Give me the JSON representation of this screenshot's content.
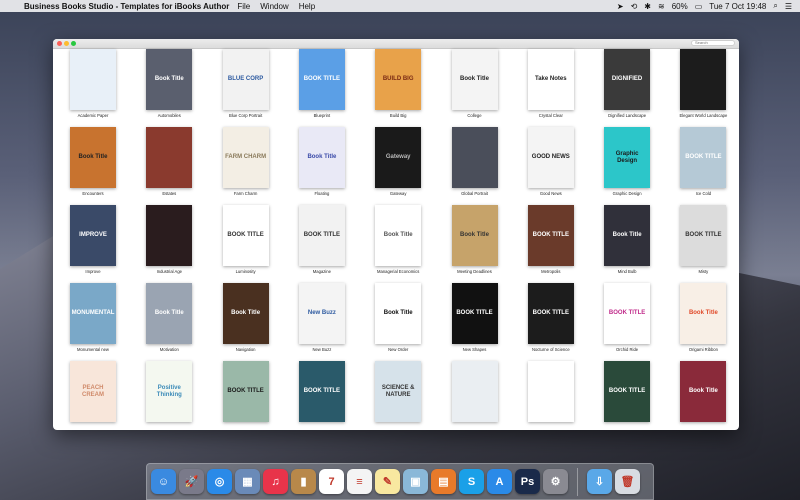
{
  "menubar": {
    "app_name": "Business Books Studio - Templates for iBooks Author",
    "menus": [
      "File",
      "Window",
      "Help"
    ],
    "battery": "60%",
    "datetime": "Tue 7 Oct  19:48"
  },
  "window": {
    "search_placeholder": "Search"
  },
  "templates": [
    {
      "name": "Academic Paper",
      "title": "",
      "bg": "#e8f0f8",
      "fg": "#2d6fb5"
    },
    {
      "name": "Automobiles",
      "title": "Book Title",
      "bg": "#5a5f6e",
      "fg": "#ffffff"
    },
    {
      "name": "Blue Corp Portrait",
      "title": "BLUE CORP",
      "bg": "#f2f2f2",
      "fg": "#2d5aa0"
    },
    {
      "name": "Blueprint",
      "title": "BOOK TITLE",
      "bg": "#5b9fe6",
      "fg": "#ffffff"
    },
    {
      "name": "Build Big",
      "title": "BUILD BIG",
      "bg": "#e8a24a",
      "fg": "#7a2a14"
    },
    {
      "name": "College",
      "title": "Book Title",
      "bg": "#f4f4f4",
      "fg": "#222222"
    },
    {
      "name": "Crystal Clear",
      "title": "Take Notes",
      "bg": "#ffffff",
      "fg": "#222222"
    },
    {
      "name": "Dignified Landscape",
      "title": "DIGNIFIED",
      "bg": "#3a3a3a",
      "fg": "#ffffff"
    },
    {
      "name": "Elegant World Landscape",
      "title": "",
      "bg": "#1c1c1c",
      "fg": "#ffffff"
    },
    {
      "name": "Encounters",
      "title": "Book Title",
      "bg": "#c8732f",
      "fg": "#222222"
    },
    {
      "name": "Estates",
      "title": "",
      "bg": "#8a3a2e",
      "fg": "#ffffff"
    },
    {
      "name": "Farm Charm",
      "title": "FARM CHARM",
      "bg": "#f3eee4",
      "fg": "#8a7a5a"
    },
    {
      "name": "Floating",
      "title": "Book Title",
      "bg": "#e9e9f6",
      "fg": "#3a4aa8"
    },
    {
      "name": "Gateway",
      "title": "Gateway",
      "bg": "#1a1a1a",
      "fg": "#bbbbbb"
    },
    {
      "name": "Global Portrait",
      "title": "",
      "bg": "#4a4e5a",
      "fg": "#ffffff"
    },
    {
      "name": "Good News",
      "title": "GOOD NEWS",
      "bg": "#f4f4f4",
      "fg": "#222222"
    },
    {
      "name": "Graphic Design",
      "title": "Graphic Design",
      "bg": "#2cc6c9",
      "fg": "#1a1a1a"
    },
    {
      "name": "Ice Cold",
      "title": "BOOK TITLE",
      "bg": "#b5c9d6",
      "fg": "#ffffff"
    },
    {
      "name": "Improve",
      "title": "IMPROVE",
      "bg": "#3a4a68",
      "fg": "#ffffff"
    },
    {
      "name": "Industrial Age",
      "title": "",
      "bg": "#2a1c1e",
      "fg": "#ffffff"
    },
    {
      "name": "Luminosity",
      "title": "BOOK TITLE",
      "bg": "#ffffff",
      "fg": "#333333"
    },
    {
      "name": "Magazine",
      "title": "BOOK TITLE",
      "bg": "#f2f2f2",
      "fg": "#333333"
    },
    {
      "name": "Managerial Economics",
      "title": "Book Title",
      "bg": "#ffffff",
      "fg": "#555555"
    },
    {
      "name": "Meeting Deadlines",
      "title": "Book Title",
      "bg": "#c6a36a",
      "fg": "#333333"
    },
    {
      "name": "Metropolis",
      "title": "BOOK TITLE",
      "bg": "#6a3a2a",
      "fg": "#ffffff"
    },
    {
      "name": "Mind Bulb",
      "title": "Book Title",
      "bg": "#30303a",
      "fg": "#ffffff"
    },
    {
      "name": "Misty",
      "title": "BOOK TITLE",
      "bg": "#dcdcdc",
      "fg": "#333333"
    },
    {
      "name": "Monumental new",
      "title": "MONUMENTAL",
      "bg": "#7aa8c8",
      "fg": "#ffffff"
    },
    {
      "name": "Motivation",
      "title": "Book Title",
      "bg": "#9aa4b2",
      "fg": "#ffffff"
    },
    {
      "name": "Navigation",
      "title": "Book Title",
      "bg": "#4a3020",
      "fg": "#ffffff"
    },
    {
      "name": "New Buzz",
      "title": "New Buzz",
      "bg": "#f4f4f4",
      "fg": "#2d5aa0"
    },
    {
      "name": "New Order",
      "title": "Book Title",
      "bg": "#ffffff",
      "fg": "#111111"
    },
    {
      "name": "New Shapes",
      "title": "BOOK TITLE",
      "bg": "#111111",
      "fg": "#ffffff"
    },
    {
      "name": "Nocturne of Science",
      "title": "BOOK TITLE",
      "bg": "#1c1c1c",
      "fg": "#ffffff"
    },
    {
      "name": "Orchid Ride",
      "title": "BOOK TITLE",
      "bg": "#ffffff",
      "fg": "#c02a8a"
    },
    {
      "name": "Origami Ribbon",
      "title": "Book Title",
      "bg": "#f8efe6",
      "fg": "#e04a2a"
    },
    {
      "name": "",
      "title": "PEACH CREAM",
      "bg": "#f8e6da",
      "fg": "#d08a6a"
    },
    {
      "name": "",
      "title": "Positive Thinking",
      "bg": "#f4f8f0",
      "fg": "#3a8ab8"
    },
    {
      "name": "",
      "title": "BOOK TITLE",
      "bg": "#9ab8a8",
      "fg": "#1a1a1a"
    },
    {
      "name": "",
      "title": "BOOK TITLE",
      "bg": "#2a5a6a",
      "fg": "#ffffff"
    },
    {
      "name": "",
      "title": "SCIENCE & NATURE",
      "bg": "#d6e2ea",
      "fg": "#333333"
    },
    {
      "name": "",
      "title": "",
      "bg": "#eaeef2",
      "fg": "#333333"
    },
    {
      "name": "",
      "title": "",
      "bg": "#ffffff",
      "fg": "#333333"
    },
    {
      "name": "",
      "title": "BOOK TITLE",
      "bg": "#2a4a3a",
      "fg": "#ffffff"
    },
    {
      "name": "",
      "title": "Book Title",
      "bg": "#8a2a3a",
      "fg": "#ffffff"
    }
  ],
  "dock": [
    {
      "name": "finder-icon",
      "glyph": "☺",
      "color": "#3a8ae0"
    },
    {
      "name": "launchpad-icon",
      "glyph": "🚀",
      "color": "#7a7a8a"
    },
    {
      "name": "safari-icon",
      "glyph": "◎",
      "color": "#2a8ae8"
    },
    {
      "name": "preview-icon",
      "glyph": "▦",
      "color": "#6a8ab8"
    },
    {
      "name": "itunes-icon",
      "glyph": "♫",
      "color": "#e8344a"
    },
    {
      "name": "ibooks-author-icon",
      "glyph": "▮",
      "color": "#b8884a"
    },
    {
      "name": "calendar-icon",
      "glyph": "7",
      "color": "#ffffff"
    },
    {
      "name": "reminders-icon",
      "glyph": "≡",
      "color": "#f4f4f4"
    },
    {
      "name": "notes-icon",
      "glyph": "✎",
      "color": "#f8e8a0"
    },
    {
      "name": "preview-photos-icon",
      "glyph": "▣",
      "color": "#8ab8d8"
    },
    {
      "name": "business-books-studio-icon",
      "glyph": "▤",
      "color": "#e87a2a"
    },
    {
      "name": "skype-icon",
      "glyph": "S",
      "color": "#1aa0e8"
    },
    {
      "name": "app-store-icon",
      "glyph": "A",
      "color": "#2a8ae8"
    },
    {
      "name": "photoshop-icon",
      "glyph": "Ps",
      "color": "#1a2a4a"
    },
    {
      "name": "system-preferences-icon",
      "glyph": "⚙",
      "color": "#8a8a92"
    },
    {
      "name": "downloads-folder-icon",
      "glyph": "⇩",
      "color": "#5aa8e8"
    },
    {
      "name": "trash-icon",
      "glyph": "🗑",
      "color": "#d8dce2"
    }
  ]
}
